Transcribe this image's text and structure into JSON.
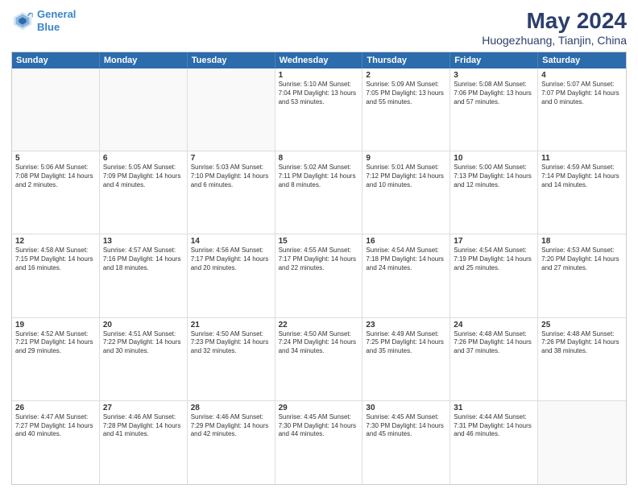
{
  "logo": {
    "line1": "General",
    "line2": "Blue"
  },
  "title": "May 2024",
  "location": "Huogezhuang, Tianjin, China",
  "header_days": [
    "Sunday",
    "Monday",
    "Tuesday",
    "Wednesday",
    "Thursday",
    "Friday",
    "Saturday"
  ],
  "weeks": [
    [
      {
        "day": "",
        "info": "",
        "shaded": true
      },
      {
        "day": "",
        "info": "",
        "shaded": true
      },
      {
        "day": "",
        "info": "",
        "shaded": true
      },
      {
        "day": "1",
        "info": "Sunrise: 5:10 AM\nSunset: 7:04 PM\nDaylight: 13 hours and 53 minutes.",
        "shaded": false
      },
      {
        "day": "2",
        "info": "Sunrise: 5:09 AM\nSunset: 7:05 PM\nDaylight: 13 hours and 55 minutes.",
        "shaded": false
      },
      {
        "day": "3",
        "info": "Sunrise: 5:08 AM\nSunset: 7:06 PM\nDaylight: 13 hours and 57 minutes.",
        "shaded": false
      },
      {
        "day": "4",
        "info": "Sunrise: 5:07 AM\nSunset: 7:07 PM\nDaylight: 14 hours and 0 minutes.",
        "shaded": false
      }
    ],
    [
      {
        "day": "5",
        "info": "Sunrise: 5:06 AM\nSunset: 7:08 PM\nDaylight: 14 hours and 2 minutes.",
        "shaded": false
      },
      {
        "day": "6",
        "info": "Sunrise: 5:05 AM\nSunset: 7:09 PM\nDaylight: 14 hours and 4 minutes.",
        "shaded": false
      },
      {
        "day": "7",
        "info": "Sunrise: 5:03 AM\nSunset: 7:10 PM\nDaylight: 14 hours and 6 minutes.",
        "shaded": false
      },
      {
        "day": "8",
        "info": "Sunrise: 5:02 AM\nSunset: 7:11 PM\nDaylight: 14 hours and 8 minutes.",
        "shaded": false
      },
      {
        "day": "9",
        "info": "Sunrise: 5:01 AM\nSunset: 7:12 PM\nDaylight: 14 hours and 10 minutes.",
        "shaded": false
      },
      {
        "day": "10",
        "info": "Sunrise: 5:00 AM\nSunset: 7:13 PM\nDaylight: 14 hours and 12 minutes.",
        "shaded": false
      },
      {
        "day": "11",
        "info": "Sunrise: 4:59 AM\nSunset: 7:14 PM\nDaylight: 14 hours and 14 minutes.",
        "shaded": false
      }
    ],
    [
      {
        "day": "12",
        "info": "Sunrise: 4:58 AM\nSunset: 7:15 PM\nDaylight: 14 hours and 16 minutes.",
        "shaded": false
      },
      {
        "day": "13",
        "info": "Sunrise: 4:57 AM\nSunset: 7:16 PM\nDaylight: 14 hours and 18 minutes.",
        "shaded": false
      },
      {
        "day": "14",
        "info": "Sunrise: 4:56 AM\nSunset: 7:17 PM\nDaylight: 14 hours and 20 minutes.",
        "shaded": false
      },
      {
        "day": "15",
        "info": "Sunrise: 4:55 AM\nSunset: 7:17 PM\nDaylight: 14 hours and 22 minutes.",
        "shaded": false
      },
      {
        "day": "16",
        "info": "Sunrise: 4:54 AM\nSunset: 7:18 PM\nDaylight: 14 hours and 24 minutes.",
        "shaded": false
      },
      {
        "day": "17",
        "info": "Sunrise: 4:54 AM\nSunset: 7:19 PM\nDaylight: 14 hours and 25 minutes.",
        "shaded": false
      },
      {
        "day": "18",
        "info": "Sunrise: 4:53 AM\nSunset: 7:20 PM\nDaylight: 14 hours and 27 minutes.",
        "shaded": false
      }
    ],
    [
      {
        "day": "19",
        "info": "Sunrise: 4:52 AM\nSunset: 7:21 PM\nDaylight: 14 hours and 29 minutes.",
        "shaded": false
      },
      {
        "day": "20",
        "info": "Sunrise: 4:51 AM\nSunset: 7:22 PM\nDaylight: 14 hours and 30 minutes.",
        "shaded": false
      },
      {
        "day": "21",
        "info": "Sunrise: 4:50 AM\nSunset: 7:23 PM\nDaylight: 14 hours and 32 minutes.",
        "shaded": false
      },
      {
        "day": "22",
        "info": "Sunrise: 4:50 AM\nSunset: 7:24 PM\nDaylight: 14 hours and 34 minutes.",
        "shaded": false
      },
      {
        "day": "23",
        "info": "Sunrise: 4:49 AM\nSunset: 7:25 PM\nDaylight: 14 hours and 35 minutes.",
        "shaded": false
      },
      {
        "day": "24",
        "info": "Sunrise: 4:48 AM\nSunset: 7:26 PM\nDaylight: 14 hours and 37 minutes.",
        "shaded": false
      },
      {
        "day": "25",
        "info": "Sunrise: 4:48 AM\nSunset: 7:26 PM\nDaylight: 14 hours and 38 minutes.",
        "shaded": false
      }
    ],
    [
      {
        "day": "26",
        "info": "Sunrise: 4:47 AM\nSunset: 7:27 PM\nDaylight: 14 hours and 40 minutes.",
        "shaded": false
      },
      {
        "day": "27",
        "info": "Sunrise: 4:46 AM\nSunset: 7:28 PM\nDaylight: 14 hours and 41 minutes.",
        "shaded": false
      },
      {
        "day": "28",
        "info": "Sunrise: 4:46 AM\nSunset: 7:29 PM\nDaylight: 14 hours and 42 minutes.",
        "shaded": false
      },
      {
        "day": "29",
        "info": "Sunrise: 4:45 AM\nSunset: 7:30 PM\nDaylight: 14 hours and 44 minutes.",
        "shaded": false
      },
      {
        "day": "30",
        "info": "Sunrise: 4:45 AM\nSunset: 7:30 PM\nDaylight: 14 hours and 45 minutes.",
        "shaded": false
      },
      {
        "day": "31",
        "info": "Sunrise: 4:44 AM\nSunset: 7:31 PM\nDaylight: 14 hours and 46 minutes.",
        "shaded": false
      },
      {
        "day": "",
        "info": "",
        "shaded": true
      }
    ]
  ]
}
